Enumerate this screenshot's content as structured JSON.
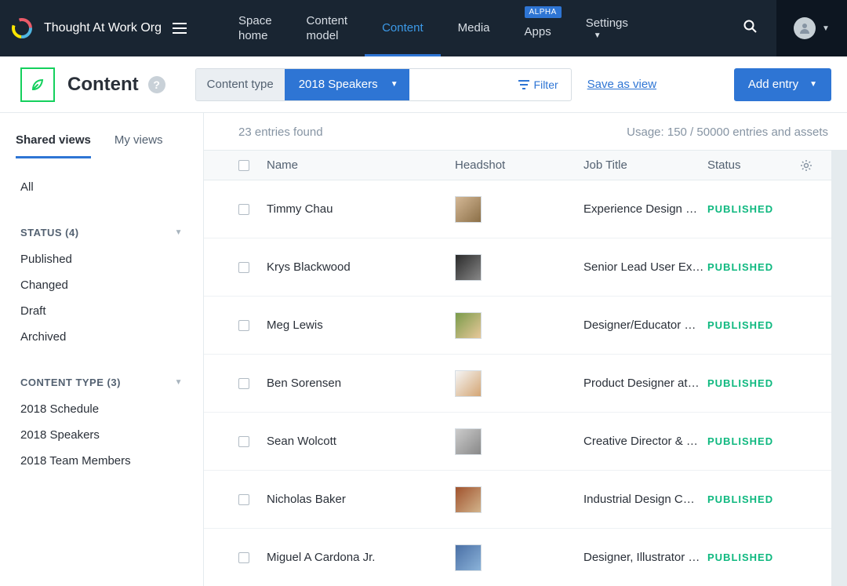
{
  "topnav": {
    "org_name": "Thought At Work Org",
    "items": [
      {
        "label": "Space\nhome"
      },
      {
        "label": "Content\nmodel"
      },
      {
        "label": "Content"
      },
      {
        "label": "Media"
      },
      {
        "label": "Apps",
        "badge": "ALPHA"
      },
      {
        "label": "Settings"
      }
    ]
  },
  "header": {
    "title": "Content",
    "content_type_label": "Content type",
    "content_type_value": "2018 Speakers",
    "filter_label": "Filter",
    "save_view": "Save as view",
    "add_entry": "Add entry"
  },
  "sidebar": {
    "tabs": [
      "Shared views",
      "My views"
    ],
    "all_label": "All",
    "status_header": "STATUS (4)",
    "status_items": [
      "Published",
      "Changed",
      "Draft",
      "Archived"
    ],
    "ct_header": "CONTENT TYPE (3)",
    "ct_items": [
      "2018 Schedule",
      "2018 Speakers",
      "2018 Team Members"
    ]
  },
  "content": {
    "entries_found": "23 entries found",
    "usage": "Usage: 150 / 50000 entries and assets",
    "columns": {
      "name": "Name",
      "headshot": "Headshot",
      "job": "Job Title",
      "status": "Status"
    },
    "rows": [
      {
        "name": "Timmy Chau",
        "job": "Experience Design …",
        "status": "PUBLISHED",
        "hs": "hs1"
      },
      {
        "name": "Krys Blackwood",
        "job": "Senior Lead User Ex…",
        "status": "PUBLISHED",
        "hs": "hs2"
      },
      {
        "name": "Meg Lewis",
        "job": "Designer/Educator …",
        "status": "PUBLISHED",
        "hs": "hs3"
      },
      {
        "name": "Ben Sorensen",
        "job": "Product Designer at…",
        "status": "PUBLISHED",
        "hs": "hs4"
      },
      {
        "name": "Sean Wolcott",
        "job": "Creative Director & …",
        "status": "PUBLISHED",
        "hs": "hs5"
      },
      {
        "name": "Nicholas Baker",
        "job": "Industrial Design C…",
        "status": "PUBLISHED",
        "hs": "hs6"
      },
      {
        "name": "Miguel A Cardona Jr.",
        "job": "Designer, Illustrator …",
        "status": "PUBLISHED",
        "hs": "hs7"
      }
    ]
  }
}
